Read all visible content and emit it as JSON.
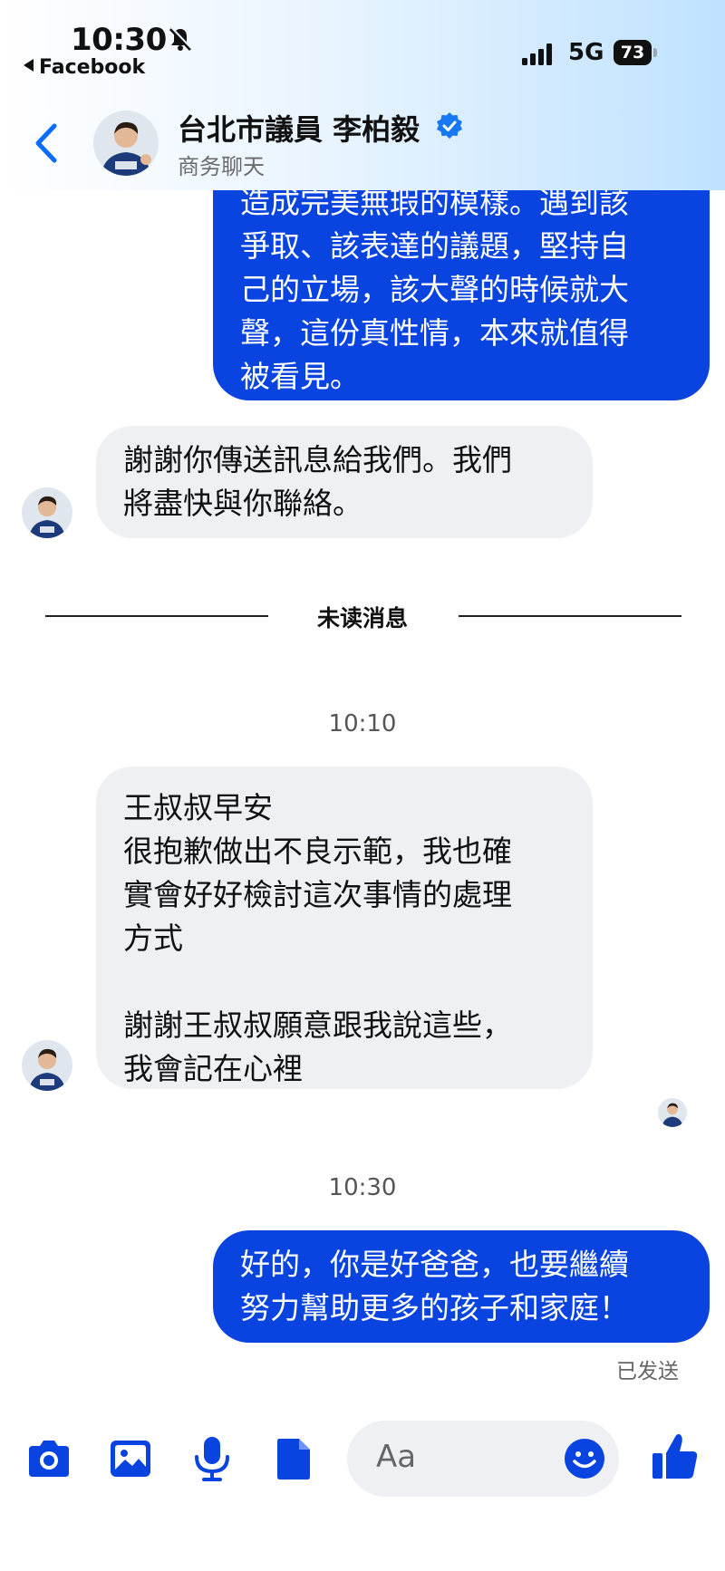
{
  "status_bar": {
    "time": "10:30",
    "back_app": "Facebook",
    "network": "5G",
    "battery": "73"
  },
  "chat_header": {
    "title": "台北市議員 李柏毅",
    "subtitle": "商务聊天"
  },
  "messages": {
    "outgoing_1": [
      "造成完美無瑕的模樣。遇到該",
      "爭取、該表達的議題，堅持自",
      "己的立場，該大聲的時候就大",
      "聲，這份真性情，本來就值得",
      "被看見。"
    ],
    "incoming_1": [
      "謝謝你傳送訊息給我們。我們",
      "將盡快與你聯絡。"
    ],
    "unread_divider": "未读消息",
    "time_1": "10:10",
    "incoming_2": [
      "王叔叔早安",
      "很抱歉做出不良示範，我也確",
      "實會好好檢討這次事情的處理",
      "方式",
      "",
      "謝謝王叔叔願意跟我說這些，",
      "我會記在心裡"
    ],
    "time_2": "10:30",
    "outgoing_2": [
      "好的，你是好爸爸，也要繼續",
      "努力幫助更多的孩子和家庭！"
    ],
    "sent_status": "已发送"
  },
  "composer": {
    "placeholder": "Aa",
    "icons": [
      "camera-icon",
      "image-icon",
      "microphone-icon",
      "file-icon",
      "emoji-icon",
      "like-icon"
    ]
  },
  "colors": {
    "accent": "#0a44e0",
    "incoming_bubble": "#eef0f3",
    "header_gradient_end": "#bfe2ff"
  }
}
